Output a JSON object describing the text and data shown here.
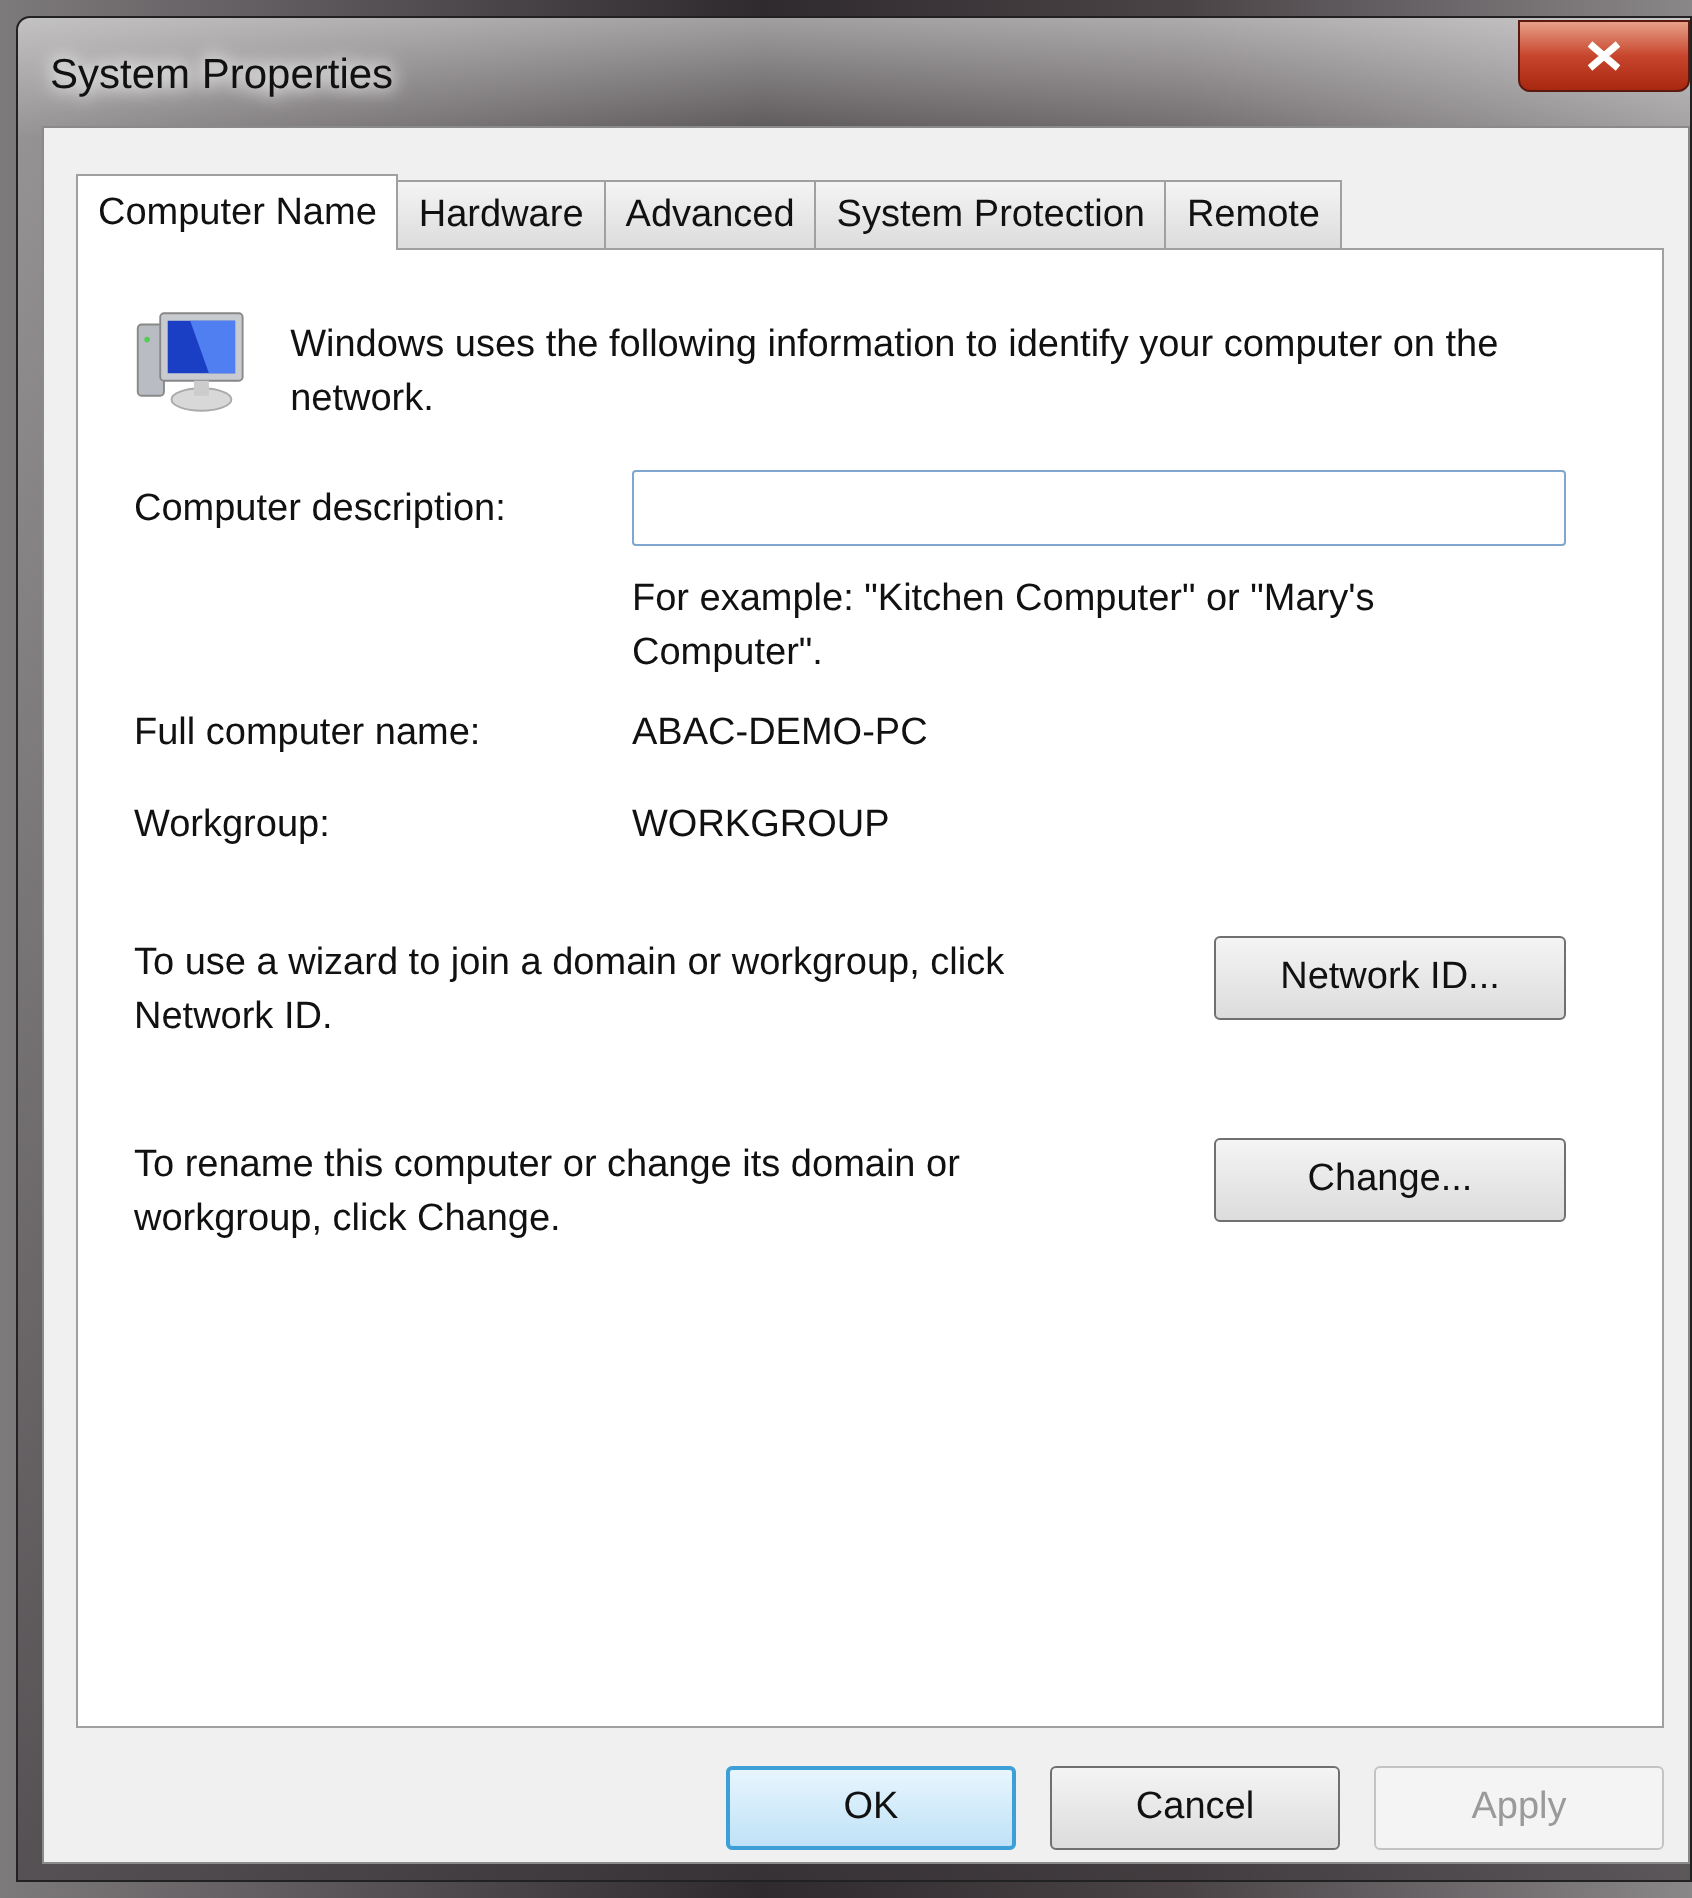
{
  "window": {
    "title": "System Properties"
  },
  "tabs": [
    {
      "label": "Computer Name",
      "selected": true
    },
    {
      "label": "Hardware",
      "selected": false
    },
    {
      "label": "Advanced",
      "selected": false
    },
    {
      "label": "System Protection",
      "selected": false
    },
    {
      "label": "Remote",
      "selected": false
    }
  ],
  "intro": "Windows uses the following information to identify your computer on the network.",
  "description_field": {
    "label": "Computer description:",
    "hint": "For example: \"Kitchen Computer\" or \"Mary's Computer\"."
  },
  "info_rows": [
    {
      "label": "Full computer name:",
      "value": "ABAC-DEMO-PC"
    },
    {
      "label": "Workgroup:",
      "value": "WORKGROUP"
    }
  ],
  "actions": [
    {
      "text": "To use a wizard to join a domain or workgroup, click Network ID.",
      "button": "Network ID..."
    },
    {
      "text": "To rename this computer or change its domain or workgroup, click Change.",
      "button": "Change..."
    }
  ],
  "buttons": [
    {
      "label": "OK",
      "default": true,
      "disabled": false
    },
    {
      "label": "Cancel",
      "default": false,
      "disabled": false
    },
    {
      "label": "Apply",
      "default": false,
      "disabled": true
    }
  ]
}
